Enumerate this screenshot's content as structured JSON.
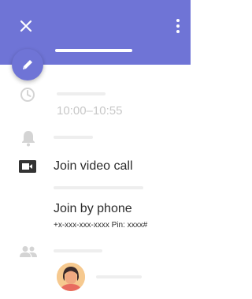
{
  "colors": {
    "header_bg": "#6f74d6",
    "placeholder": "#eeeeee",
    "muted_icon": "#d4d4d4",
    "text": "#2b2b2b",
    "muted_text": "#c8c8c8"
  },
  "header": {
    "close_icon": "close-icon",
    "more_icon": "more-vert-icon",
    "edit_icon": "pencil-icon"
  },
  "event": {
    "time_icon": "clock-icon",
    "time": "10:00–10:55",
    "reminder_icon": "bell-icon"
  },
  "conference": {
    "video_icon": "video-camera-icon",
    "join_video_label": "Join video call",
    "join_phone_label": "Join by phone",
    "phone_details": "+x-xxx-xxx-xxxx  Pin: xxxx#"
  },
  "guests": {
    "icon": "people-icon"
  }
}
